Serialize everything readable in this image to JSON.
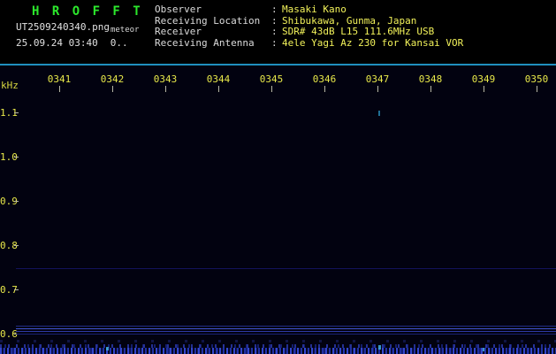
{
  "header": {
    "title": "H R O F F T",
    "filename": "UT2509240340.png",
    "mode_label": "meteor",
    "datetime": "25.09.24 03:40",
    "counter": "0..",
    "info_rows": [
      {
        "label": "Observer",
        "sep": ":",
        "value": "Masaki Kano"
      },
      {
        "label": "Receiving Location",
        "sep": ":",
        "value": "Shibukawa, Gunma, Japan"
      },
      {
        "label": "Receiver",
        "sep": ":",
        "value": "SDR# 43dB L15 111.6MHz USB"
      },
      {
        "label": "Receiving Antenna",
        "sep": ":",
        "value": "4ele Yagi Az 230 for Kansai VOR"
      }
    ]
  },
  "chart_data": {
    "type": "heatmap",
    "title": "",
    "xlabel": "",
    "ylabel": "kHz",
    "x_ticks": [
      "0341",
      "0342",
      "0343",
      "0344",
      "0345",
      "0346",
      "0347",
      "0348",
      "0349",
      "0350"
    ],
    "y_ticks": [
      "1.1",
      "1.0",
      "0.9",
      "0.8",
      "0.7",
      "0.6"
    ],
    "x_range_ut": [
      "03:40",
      "03:50"
    ],
    "y_range_khz": [
      0.55,
      1.16
    ],
    "grid": false,
    "legend": "none",
    "features": [
      {
        "kind": "faint horizontal carrier line",
        "freq_khz": 0.75,
        "time_extent": "full width"
      },
      {
        "kind": "carrier lines",
        "freq_khz": [
          0.62,
          0.61,
          0.6
        ],
        "time_extent": "full width"
      },
      {
        "kind": "broadband noise band",
        "freq_khz_range": [
          0.55,
          0.58
        ],
        "time_extent": "full width"
      },
      {
        "kind": "weak point echo",
        "time": "0347",
        "freq_khz": 1.09
      }
    ]
  },
  "colors": {
    "title_green": "#2ce82c",
    "label_white": "#dcdcdc",
    "value_yellow": "#f2f25a",
    "axis_yellow": "#e8e84a",
    "separator_cyan": "#1f8fbe",
    "plot_background": "#020210",
    "carrier_blue": "#4254d0",
    "noise_blue": "#2c40c0"
  }
}
